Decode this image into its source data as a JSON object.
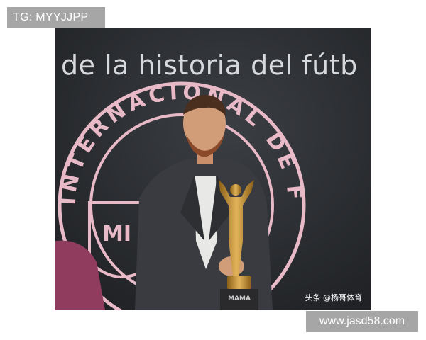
{
  "overlay": {
    "tag_label": "TG: MYYJJPP",
    "site_watermark": "www.jasd58.com"
  },
  "photo": {
    "banner_text": "de la historia del fútb",
    "emblem_text": "INTERNACIONAL DE FÚTBOL",
    "emblem_monogram": "MI",
    "base_plate_text": "MAMA",
    "credit_text": "头条 @杨哥体育"
  },
  "colors": {
    "background_wall": "#2b2d30",
    "emblem_pink": "#e8b9c6",
    "jacket": "#3a3b40",
    "trophy_gold": "#c9952e",
    "watermark_gray": "#a6a6a6"
  }
}
